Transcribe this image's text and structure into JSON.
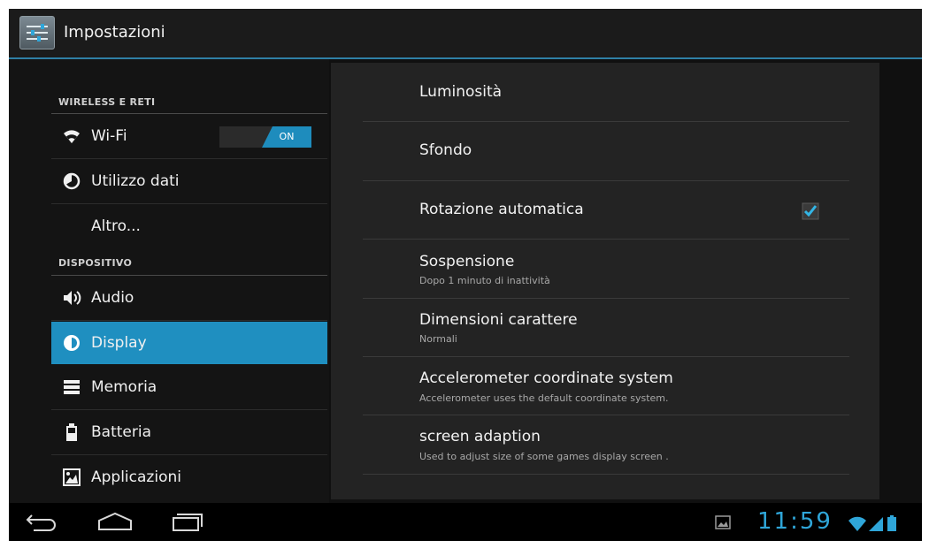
{
  "header": {
    "title": "Impostazioni",
    "icon": "settings-sliders-icon"
  },
  "sidebar": {
    "sections": [
      {
        "header": "WIRELESS E RETI"
      },
      {
        "header": "DISPOSITIVO"
      }
    ],
    "items": [
      {
        "label": "Wi-Fi",
        "icon": "wifi-icon",
        "toggle": "ON"
      },
      {
        "label": "Utilizzo dati",
        "icon": "data-usage-icon"
      },
      {
        "label": "Altro...",
        "icon": ""
      },
      {
        "label": "Audio",
        "icon": "speaker-icon"
      },
      {
        "label": "Display",
        "icon": "display-icon",
        "selected": true
      },
      {
        "label": "Memoria",
        "icon": "storage-icon"
      },
      {
        "label": "Batteria",
        "icon": "battery-icon"
      },
      {
        "label": "Applicazioni",
        "icon": "apps-icon"
      }
    ]
  },
  "display_settings": [
    {
      "title": "Luminosità",
      "summary": ""
    },
    {
      "title": "Sfondo",
      "summary": ""
    },
    {
      "title": "Rotazione automatica",
      "summary": "",
      "checked": true
    },
    {
      "title": "Sospensione",
      "summary": "Dopo 1 minuto di inattività"
    },
    {
      "title": "Dimensioni carattere",
      "summary": "Normali"
    },
    {
      "title": "Accelerometer coordinate system",
      "summary": "Accelerometer uses the default coordinate system."
    },
    {
      "title": "screen adaption",
      "summary": "Used to adjust size of some games display screen ."
    }
  ],
  "statusbar": {
    "time": "11:59"
  },
  "colors": {
    "accent": "#1f8fc0",
    "clock": "#2fa6d9",
    "background": "#101010"
  }
}
